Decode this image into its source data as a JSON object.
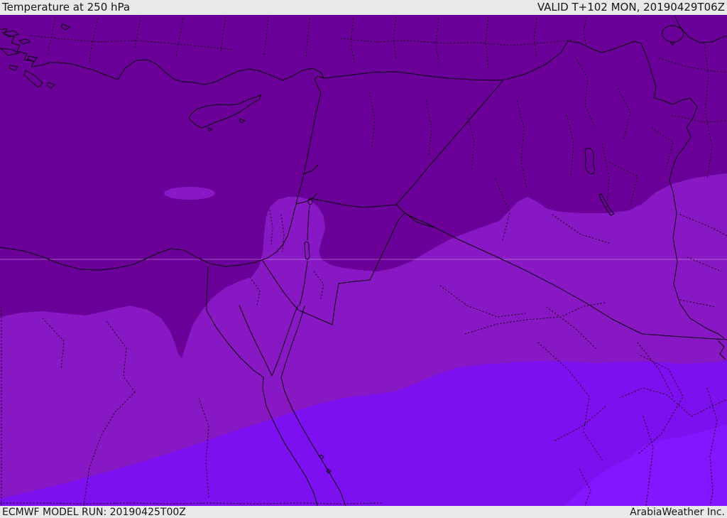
{
  "header": {
    "title": "Temperature at 250 hPa",
    "valid_label": "VALID T+102 MON, 20190429T06Z"
  },
  "footer": {
    "model_run": "ECMWF MODEL RUN: 20190425T00Z",
    "credit": "ArabiaWeather Inc."
  },
  "map": {
    "kind": "filled-contour temperature field over Middle East / Eastern Mediterranean",
    "bands_order_north_to_south": [
      "coldest",
      "cold",
      "mild",
      "warm"
    ],
    "palette": {
      "band_coldest": "#6b0099",
      "band_cold": "#8818c4",
      "band_mild": "#7d10ee",
      "band_warm": "#8315ff",
      "coastline": "#0d000d",
      "admin_boundary": "#1c011c",
      "graticule": "rgba(255,255,255,0.33)",
      "frame_bg": "#e9e9e9",
      "frame_text": "#161616"
    }
  }
}
